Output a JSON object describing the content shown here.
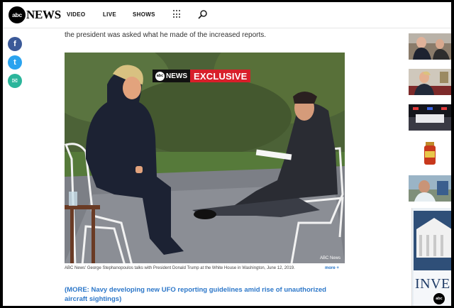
{
  "header": {
    "logo_badge": "abc",
    "logo_word": "NEWS",
    "nav": [
      {
        "label": "VIDEO"
      },
      {
        "label": "LIVE"
      },
      {
        "label": "SHOWS"
      }
    ],
    "icons": [
      "grid-icon",
      "search-icon"
    ]
  },
  "share": {
    "facebook_glyph": "f",
    "twitter_glyph": "t",
    "email_glyph": "✉",
    "colors": {
      "facebook": "#3b5998",
      "twitter": "#2aa3ef",
      "email": "#2bb59b"
    }
  },
  "article": {
    "preceding_text": "the president was asked what he made of the increased reports.",
    "photo": {
      "badge_brand": "NEWS",
      "badge_brand_circle": "abc",
      "badge_label": "EXCLUSIVE",
      "credit": "ABC News"
    },
    "caption": "ABC News' George Stephanopoulos talks with President Donald Trump at the White House in Washington, June 12, 2019.",
    "caption_more": "more +",
    "related_link": "(MORE: Navy developing new UFO reporting guidelines amid rise of unauthorized aircraft sightings)",
    "link_color": "#2c77c9",
    "accent_red": "#d81f2a"
  },
  "rail": {
    "ad_text": "INVE",
    "ad_badge": "abc"
  }
}
